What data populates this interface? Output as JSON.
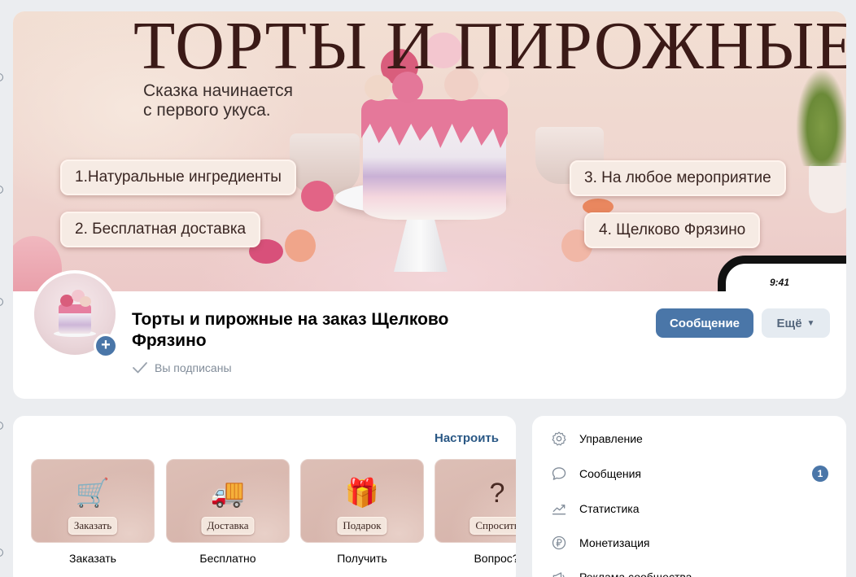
{
  "cover": {
    "title": "ТОРТЫ И ПИРОЖНЫЕ",
    "subtitle_line1": "Сказка начинается",
    "subtitle_line2": "с первого укуса.",
    "features": [
      "1.Натуральные ингредиенты",
      "2. Бесплатная доставка",
      "3. На любое мероприятие",
      "4. Щелково Фрязино"
    ],
    "phone_time": "9:41"
  },
  "profile": {
    "name": "Торты и пирожные на заказ Щелково Фрязино",
    "subscribed_status": "Вы подписаны",
    "message_button": "Сообщение",
    "more_button": "Ещё",
    "add_icon": "+"
  },
  "services": {
    "configure_link": "Настроить",
    "items": [
      {
        "tile_label": "Заказать",
        "caption": "Заказать",
        "icon": "shopping-cart-icon"
      },
      {
        "tile_label": "Доставка",
        "caption": "Бесплатно",
        "icon": "delivery-truck-icon"
      },
      {
        "tile_label": "Подарок",
        "caption": "Получить",
        "icon": "gift-icon"
      },
      {
        "tile_label": "Спросить",
        "caption": "Вопрос?",
        "icon": "question-icon"
      }
    ]
  },
  "management": {
    "items": [
      {
        "label": "Управление",
        "icon": "gear-icon"
      },
      {
        "label": "Сообщения",
        "icon": "chat-bubble-icon",
        "badge": "1"
      },
      {
        "label": "Статистика",
        "icon": "trend-chart-icon"
      },
      {
        "label": "Монетизация",
        "icon": "ruble-coin-icon"
      },
      {
        "label": "Реклама сообщества",
        "icon": "megaphone-icon"
      }
    ]
  },
  "colors": {
    "accent": "#4a76a8",
    "link": "#2a5885",
    "background": "#ebedf0",
    "muted_text": "#818c99"
  }
}
